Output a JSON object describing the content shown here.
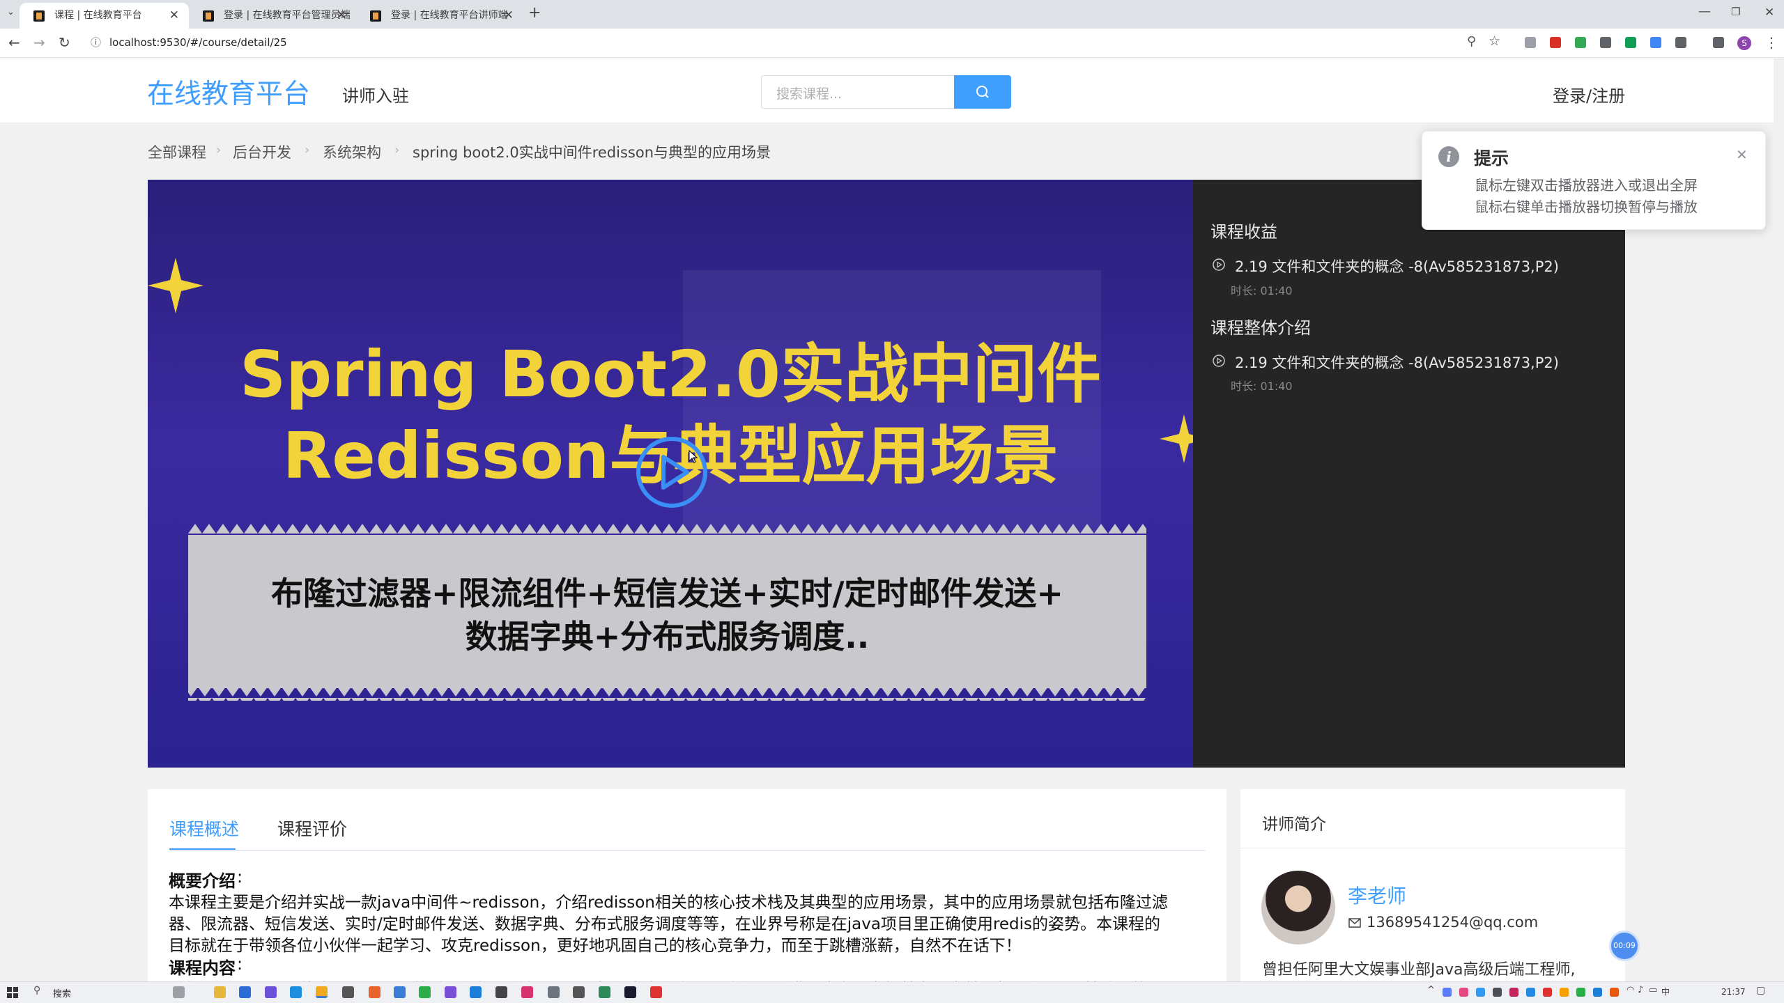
{
  "browser": {
    "tabs": [
      {
        "label": "课程 | 在线教育平台"
      },
      {
        "label": "登录 | 在线教育平台管理员端"
      },
      {
        "label": "登录 | 在线教育平台讲师端"
      }
    ],
    "new_tab": "+",
    "close": "✕",
    "url": "localhost:9530/#/course/detail/25",
    "profile_initial": "S"
  },
  "header": {
    "logo": "在线教育平台",
    "nav_link": "讲师入驻",
    "search_placeholder": "搜索课程...",
    "login": "登录/注册"
  },
  "breadcrumb": [
    "全部课程",
    "后台开发",
    "系统架构",
    "spring boot2.0实战中间件redisson与典型的应用场景"
  ],
  "toast": {
    "title": "提示",
    "lines": [
      "鼠标左键双击播放器进入或退出全屏",
      "鼠标右键单击播放器切换暂停与播放"
    ]
  },
  "video": {
    "title_line1": "Spring Boot2.0实战中间件",
    "title_line2": "Redisson与典型应用场景",
    "subtitle_line1": "布隆过滤器+限流组件+短信发送+实时/定时邮件发送+",
    "subtitle_line2": "数据字典+分布式服务调度.."
  },
  "chapters": [
    {
      "heading": "课程收益",
      "item": "2.19 文件和文件夹的概念 -8(Av585231873,P2)",
      "duration": "时长: 01:40"
    },
    {
      "heading": "课程整体介绍",
      "item": "2.19 文件和文件夹的概念 -8(Av585231873,P2)",
      "duration": "时长: 01:40"
    }
  ],
  "tabs": [
    {
      "label": "课程概述",
      "active": true
    },
    {
      "label": "课程评价",
      "active": false
    }
  ],
  "overview": {
    "intro_label": "概要介绍",
    "intro_colon": ":",
    "intro_lines": [
      "本课程主要是介绍并实战一款java中间件~redisson，介绍redisson相关的核心技术栈及其典型的应用场景，其中的应用场景就包括布隆过滤",
      "器、限流器、短信发送、实时/定时邮件发送、数据字典、分布式服务调度等等，在业界号称是在java项目里正确使用redis的姿势。本课程的",
      "目标就在于带领各位小伙伴一起学习、攻克redisson，更好地巩固自己的核心竞争力，而至于跳槽涨薪，自然不在话下！"
    ],
    "content_label": "课程内容",
    "content_colon": ":",
    "content_partial": "说起redisson，可能大伙儿不是很熟悉，但如果说起redis，想必肯定很多人都晓得。没错，这家伙它如其名，它就是架设在redis基础上的"
  },
  "teacher": {
    "heading": "讲师简介",
    "name": "李老师",
    "email": "13689541254@qq.com",
    "bio": "曾担任阿里大文娱事业部Java高级后端工程师,"
  },
  "timer_badge": "00:09",
  "taskbar": {
    "search": "搜索",
    "clock": "21:37"
  },
  "colors": {
    "accent": "#409eff",
    "video_bg": "#2e2396",
    "title_yellow": "#f2d33a"
  }
}
